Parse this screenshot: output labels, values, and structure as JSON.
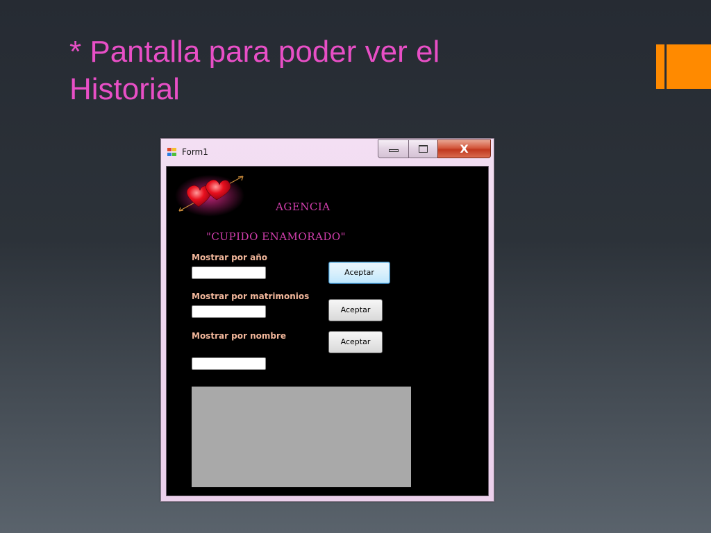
{
  "slide": {
    "title_line1": "* Pantalla para poder ver el",
    "title_line2": "Historial",
    "accent_color": "#ff8a00",
    "title_color": "#e84fc6"
  },
  "window": {
    "title": "Form1",
    "icon": "form-app-icon",
    "caption_icons": [
      "minimize-icon",
      "maximize-icon",
      "close-icon"
    ],
    "close_glyph": "X"
  },
  "form": {
    "logo_icon": "hearts-arrow-icon",
    "heading1": "AGENCIA",
    "heading2": "\"CUPIDO ENAMORADO\"",
    "heading_color": "#d33fae",
    "label_color": "#f2b79b",
    "year": {
      "label": "Mostrar por año",
      "value": "",
      "button": "Aceptar"
    },
    "marriages": {
      "label": "Mostrar por matrimonios",
      "value": "",
      "button": "Aceptar"
    },
    "name": {
      "label": "Mostrar por nombre",
      "value": "",
      "button": "Aceptar"
    }
  }
}
